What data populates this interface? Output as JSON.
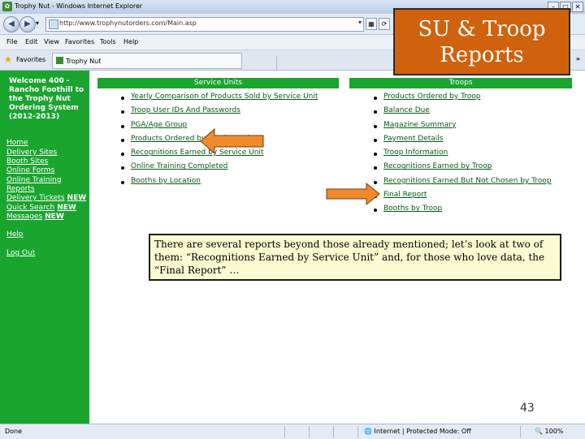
{
  "browser": {
    "title": "Trophy Nut - Windows Internet Explorer",
    "address": "http://www.trophynutorders.com/Main.asp",
    "menu": [
      "File",
      "Edit",
      "View",
      "Favorites",
      "Tools",
      "Help"
    ],
    "favorites_label": "Favorites",
    "tab_title": "Trophy Nut",
    "status_left": "Done",
    "status_zone": "Internet | Protected Mode: Off",
    "zoom": "100%"
  },
  "sidebar": {
    "welcome": "Welcome 400 - Rancho Foothill to the Trophy Nut Ordering System (2012-2013)",
    "links": [
      {
        "label": "Home",
        "badge": ""
      },
      {
        "label": "Delivery Sites",
        "badge": ""
      },
      {
        "label": "Booth Sites",
        "badge": ""
      },
      {
        "label": "Online Forms",
        "badge": ""
      },
      {
        "label": "Online Training",
        "badge": ""
      },
      {
        "label": "Reports",
        "badge": ""
      },
      {
        "label": "Delivery Tickets",
        "badge": "NEW"
      },
      {
        "label": "Quick Search",
        "badge": "NEW"
      },
      {
        "label": "Messages",
        "badge": "NEW"
      }
    ],
    "help": "Help",
    "logout": "Log Out"
  },
  "service_units": {
    "header": "Service Units",
    "reports": [
      "Yearly Comparison of Products Sold by Service Unit",
      "Troop User IDs And Passwords",
      "PGA/Age Group",
      "Products Ordered by Service Unit",
      "Recognitions Earned by Service Unit",
      "Online Training Completed",
      "Booths by Location"
    ]
  },
  "troops": {
    "header": "Troops",
    "reports": [
      "Products Ordered by Troop",
      "Balance Due",
      "Magazine Summary",
      "Payment Details",
      "Troop Information",
      "Recognitions Earned by Troop",
      "Recognitions Earned But Not Chosen by Troop",
      "Final Report",
      "Booths by Troop"
    ]
  },
  "callout": {
    "line1": "SU & Troop",
    "line2": "Reports"
  },
  "note": "There are several reports beyond those already mentioned; let’s look at two of them: “Recognitions Earned by Service Unit” and, for those who love data, the “Final Report” …",
  "slide_number": "43",
  "colors": {
    "sidebar_green": "#1aa52f",
    "callout_orange": "#d0620e",
    "arrow_orange": "#f08a2c",
    "note_bg": "#fbfad0"
  }
}
